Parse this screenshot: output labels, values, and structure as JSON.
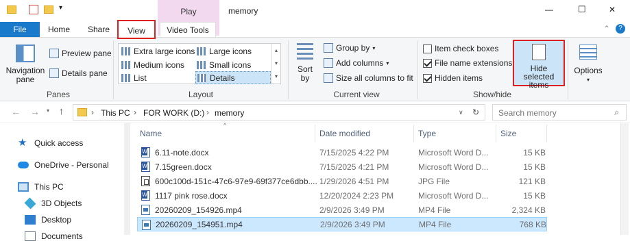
{
  "window": {
    "title": "memory",
    "context_tab": "Play",
    "min": "—",
    "max": "☐",
    "close": "✕",
    "help": "?",
    "collapse": "⌃"
  },
  "tabs": [
    "File",
    "Home",
    "Share",
    "View",
    "Video Tools"
  ],
  "ribbon": {
    "panes": {
      "navigation_pane": "Navigation\npane",
      "preview_pane": "Preview pane",
      "details_pane": "Details pane",
      "label": "Panes"
    },
    "layout": {
      "items": [
        "Extra large icons",
        "Large icons",
        "Medium icons",
        "Small icons",
        "List",
        "Details"
      ],
      "label": "Layout"
    },
    "current_view": {
      "sort_by": "Sort\nby",
      "group_by": "Group by",
      "add_columns": "Add columns",
      "size_all": "Size all columns to fit",
      "label": "Current view"
    },
    "show_hide": {
      "item_check_boxes": "Item check boxes",
      "file_name_extensions": "File name extensions",
      "hidden_items": "Hidden items",
      "hide_selected": "Hide selected\nitems",
      "label": "Show/hide",
      "checks": [
        false,
        true,
        true
      ]
    },
    "options": "Options"
  },
  "address": {
    "path": [
      "This PC",
      "FOR WORK (D:)",
      "memory"
    ],
    "search_placeholder": "Search memory"
  },
  "nav": [
    {
      "label": "Quick access",
      "icon": "star-icon",
      "color": "#1f6fc4"
    },
    {
      "label": "OneDrive - Personal",
      "icon": "cloud-icon",
      "color": "#1e88e5"
    },
    {
      "label": "This PC",
      "icon": "computer-icon",
      "color": "#4a8fd0"
    },
    {
      "label": "3D Objects",
      "icon": "cube-icon",
      "color": "#38a8d8"
    },
    {
      "label": "Desktop",
      "icon": "desktop-icon",
      "color": "#2f7fd1"
    },
    {
      "label": "Documents",
      "icon": "documents-icon",
      "color": "#6a7b8c"
    }
  ],
  "columns": [
    "Name",
    "Date modified",
    "Type",
    "Size"
  ],
  "files": [
    {
      "name": "6.11-note.docx",
      "date": "7/15/2025 4:22 PM",
      "type": "Microsoft Word D...",
      "size": "15 KB",
      "icon": "word"
    },
    {
      "name": "7.15green.docx",
      "date": "7/15/2025 4:21 PM",
      "type": "Microsoft Word D...",
      "size": "15 KB",
      "icon": "word"
    },
    {
      "name": "600c100d-151c-47c6-97e9-69f377ce6dbb....",
      "date": "1/29/2026 4:51 PM",
      "type": "JPG File",
      "size": "121 KB",
      "icon": "jpg"
    },
    {
      "name": "1117 pink rose.docx",
      "date": "12/20/2024 2:23 PM",
      "type": "Microsoft Word D...",
      "size": "15 KB",
      "icon": "word"
    },
    {
      "name": "20260209_154926.mp4",
      "date": "2/9/2026 3:49 PM",
      "type": "MP4 File",
      "size": "2,324 KB",
      "icon": "mp4"
    },
    {
      "name": "20260209_154951.mp4",
      "date": "2/9/2026 3:49 PM",
      "type": "MP4 File",
      "size": "768 KB",
      "icon": "mp4"
    }
  ]
}
